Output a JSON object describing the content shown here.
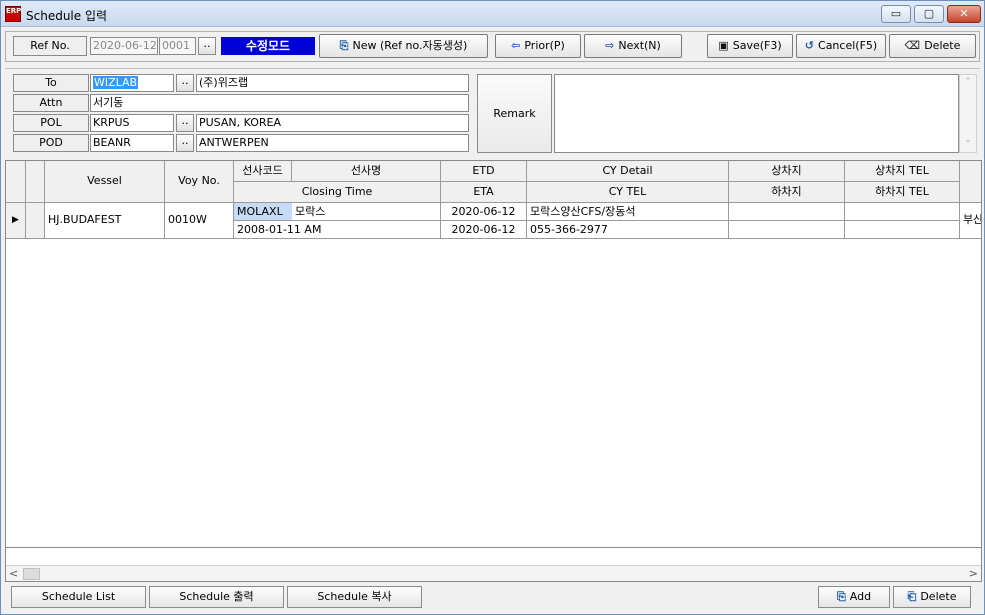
{
  "window": {
    "title": "Schedule 입력",
    "app_icon_text": "ERP",
    "minimize": "▭",
    "maximize": "▢",
    "close": "✕"
  },
  "toolbar": {
    "ref_label": "Ref No.",
    "ref_date": "2020-06-12",
    "ref_seq": "0001",
    "browse": "..",
    "mode": "수정모드",
    "new_label": "New (Ref no.자동생성)",
    "prior_label": "Prior(P)",
    "next_label": "Next(N)",
    "save_label": "Save(F3)",
    "cancel_label": "Cancel(F5)",
    "delete_label": "Delete"
  },
  "form": {
    "to_label": "To",
    "to_code": "WIZLAB",
    "to_name": "(주)위즈랩",
    "attn_label": "Attn",
    "attn_value": "서기동",
    "pol_label": "POL",
    "pol_code": "KRPUS",
    "pol_name": "PUSAN, KOREA",
    "pod_label": "POD",
    "pod_code": "BEANR",
    "pod_name": "ANTWERPEN",
    "remark_label": "Remark",
    "remark_value": ""
  },
  "grid": {
    "headers": {
      "vessel": "Vessel",
      "voy": "Voy No.",
      "carrier_code": "선사코드",
      "carrier_name": "선사명",
      "closing_time": "Closing Time",
      "etd": "ETD",
      "eta": "ETA",
      "cy_detail": "CY Detail",
      "cy_tel": "CY TEL",
      "loading_place": "상차지",
      "unloading_place": "하차지",
      "loading_tel": "상차지 TEL",
      "unloading_tel": "하차지 TEL"
    },
    "rows": [
      {
        "indicator": "▶",
        "vessel": "HJ.BUDAFEST",
        "voy": "0010W",
        "carrier_code": "MOLAXL",
        "carrier_name": "모락스",
        "closing_time": "2008-01-11 AM",
        "etd": "2020-06-12",
        "eta": "2020-06-12",
        "cy_detail": "모락스양산CFS/장동석",
        "cy_tel": "055-366-2977",
        "loading_place": "",
        "unloading_place": "",
        "loading_tel": "",
        "unloading_tel": "",
        "overflow": "부산"
      }
    ]
  },
  "bottom": {
    "schedule_list": "Schedule List",
    "schedule_print": "Schedule 출력",
    "schedule_copy": "Schedule 복사",
    "add": "Add",
    "delete": "Delete"
  }
}
